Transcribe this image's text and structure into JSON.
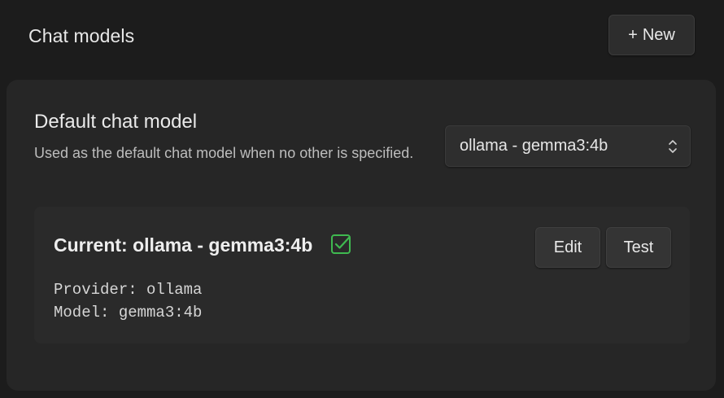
{
  "header": {
    "title": "Chat models",
    "new_button": {
      "icon": "+",
      "label": "New"
    }
  },
  "default_model": {
    "title": "Default chat model",
    "description": "Used as the default chat model when no other is specified.",
    "selected_value": "ollama - gemma3:4b"
  },
  "current_card": {
    "title": "Current: ollama - gemma3:4b",
    "status_icon": "checkbox-checked-icon",
    "status_color": "#3fb950",
    "provider_line": "Provider: ollama",
    "model_line": "Model: gemma3:4b",
    "edit_label": "Edit",
    "test_label": "Test"
  }
}
